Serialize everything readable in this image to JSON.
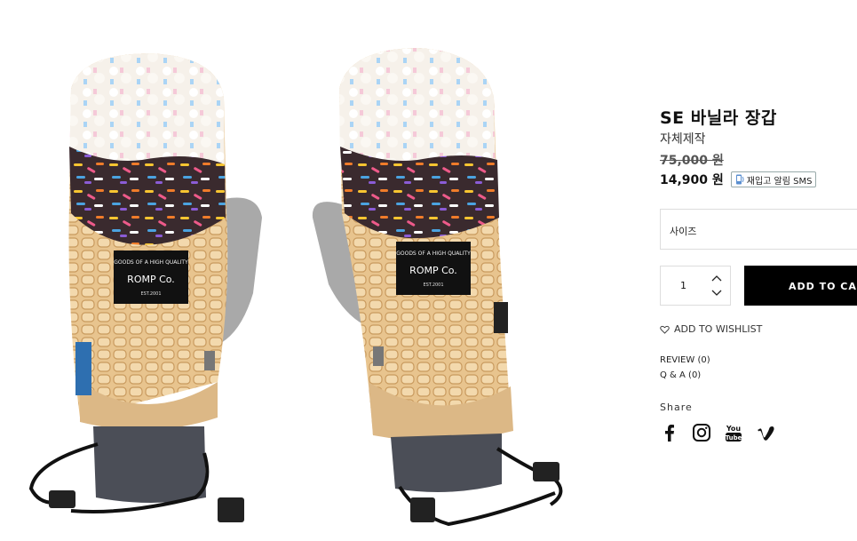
{
  "product": {
    "title": "SE 바닐라 장갑",
    "brand": "자체제작",
    "original_price": "75,000 원",
    "sale_price": "14,900 원",
    "restock_alert_label": "재입고 알림 SMS"
  },
  "options": {
    "size_label": "사이즈"
  },
  "cart": {
    "quantity": "1",
    "add_to_cart_label": "ADD TO CART"
  },
  "links": {
    "wishlist": "ADD TO WISHLIST",
    "review": "REVIEW (0)",
    "qna": "Q & A (0)",
    "share": "Share"
  },
  "gallery": {
    "patch_lines": [
      "GOODS OF A HIGH QUALITY",
      "ROMP Co.",
      "EST.2001"
    ]
  },
  "social_icons": [
    "facebook-icon",
    "instagram-icon",
    "youtube-icon",
    "vimeo-icon"
  ]
}
